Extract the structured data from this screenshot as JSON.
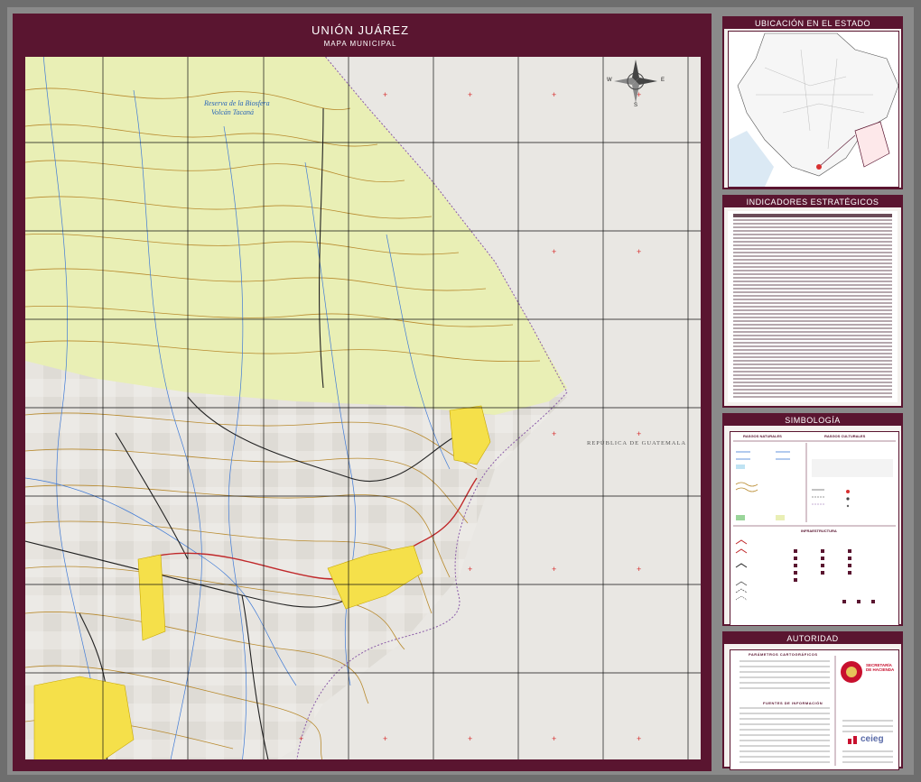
{
  "map": {
    "title": "UNIÓN JUÁREZ",
    "subtitle": "MAPA MUNICIPAL",
    "labels": {
      "reserve": "Reserva de la Biosfera",
      "reserve2": "Volcán Tacaná",
      "country": "REPÚBLICA DE GUATEMALA"
    },
    "compass": {
      "n": "N",
      "s": "S",
      "e": "E",
      "w": "W"
    },
    "colors": {
      "frame": "#5a1530",
      "reserve_fill": "#e9efb5",
      "urban_fill": "#f5e04a",
      "contour": "#b88a2e",
      "river": "#3f7ad6",
      "road": "#222222",
      "highway": "#c0282a"
    }
  },
  "panels": {
    "location": {
      "title": "UBICACIÓN EN EL ESTADO"
    },
    "indicators": {
      "title": "INDICADORES ESTRATÉGICOS"
    },
    "legend": {
      "title": "SIMBOLOGÍA",
      "natural": "RASGOS NATURALES",
      "cultural": "RASGOS CULTURALES",
      "infra": "INFRAESTRUCTURA"
    },
    "authority": {
      "title": "AUTORIDAD",
      "params": "PARÁMETROS CARTOGRÁFICOS",
      "sources": "FUENTES DE INFORMACIÓN",
      "agency": "SECRETARÍA DE HACIENDA",
      "ceieg": "ceieg"
    }
  }
}
